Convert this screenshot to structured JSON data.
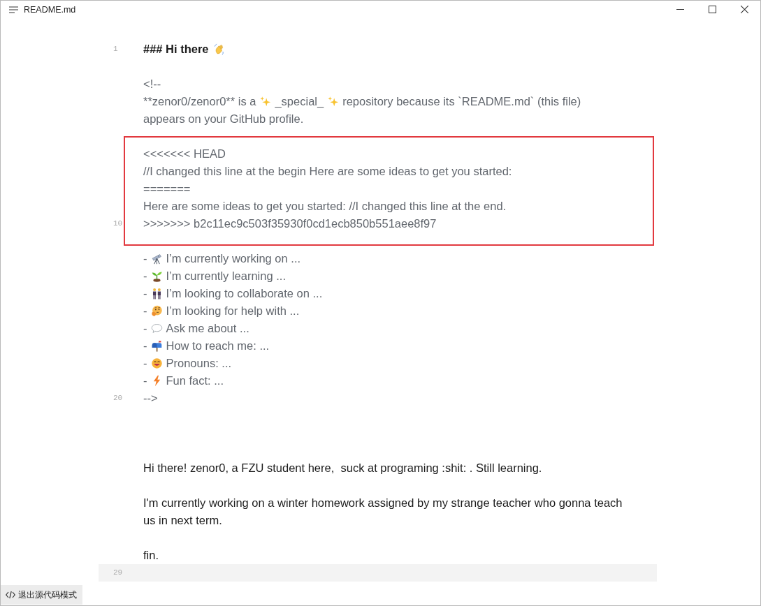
{
  "window": {
    "title": "README.md"
  },
  "editor": {
    "lines": [
      {
        "kind": "heading",
        "number": "1",
        "text": "### Hi there"
      },
      {
        "kind": "blank"
      },
      {
        "kind": "comment",
        "text": "<!--"
      },
      {
        "kind": "comment_parts",
        "parts": [
          "**zenor0/zenor0** is a",
          "_special_",
          "repository because its `README.md` (this file)"
        ],
        "wrap": "appears on your GitHub profile."
      },
      {
        "kind": "blank"
      },
      {
        "kind": "annotated",
        "lines": [
          {
            "kind": "comment",
            "text": "<<<<<<< HEAD"
          },
          {
            "kind": "comment",
            "text": "//I changed this line at the begin Here are some ideas to get you started:"
          },
          {
            "kind": "comment",
            "text": "======="
          },
          {
            "kind": "comment",
            "text": "Here are some ideas to get you started: //I changed this line at the end."
          },
          {
            "kind": "comment",
            "number": "10",
            "text": ">>>>>>> b2c11ec9c503f35930f0cd1ecb850b551aee8f97"
          }
        ]
      },
      {
        "kind": "blank"
      },
      {
        "kind": "list_item",
        "marker": "-",
        "text": "I’m currently working on ..."
      },
      {
        "kind": "list_item",
        "marker": "-",
        "text": "I’m currently learning ..."
      },
      {
        "kind": "list_item",
        "marker": "-",
        "text": "I’m looking to collaborate on ..."
      },
      {
        "kind": "list_item",
        "marker": "-",
        "text": "I’m looking for help with ..."
      },
      {
        "kind": "list_item",
        "marker": "-",
        "text": "Ask me about ..."
      },
      {
        "kind": "list_item",
        "marker": "-",
        "text": "How to reach me: ..."
      },
      {
        "kind": "list_item",
        "marker": "-",
        "text": "Pronouns: ..."
      },
      {
        "kind": "list_item",
        "marker": "-",
        "text": "Fun fact: ..."
      },
      {
        "kind": "comment",
        "number": "20",
        "text": "-->"
      },
      {
        "kind": "blank"
      },
      {
        "kind": "blank"
      },
      {
        "kind": "blank"
      },
      {
        "kind": "text",
        "text": "Hi there! zenor0, a FZU student here,  suck at programing :shit: . Still learning."
      },
      {
        "kind": "blank"
      },
      {
        "kind": "text",
        "text": "I'm currently working on a winter homework assigned by my strange teacher who gonna teach",
        "wrap": "us in next term."
      },
      {
        "kind": "blank"
      },
      {
        "kind": "text",
        "text": "fin."
      },
      {
        "kind": "current",
        "number": "29"
      }
    ]
  },
  "mode_button": {
    "label": "退出源代码模式"
  }
}
